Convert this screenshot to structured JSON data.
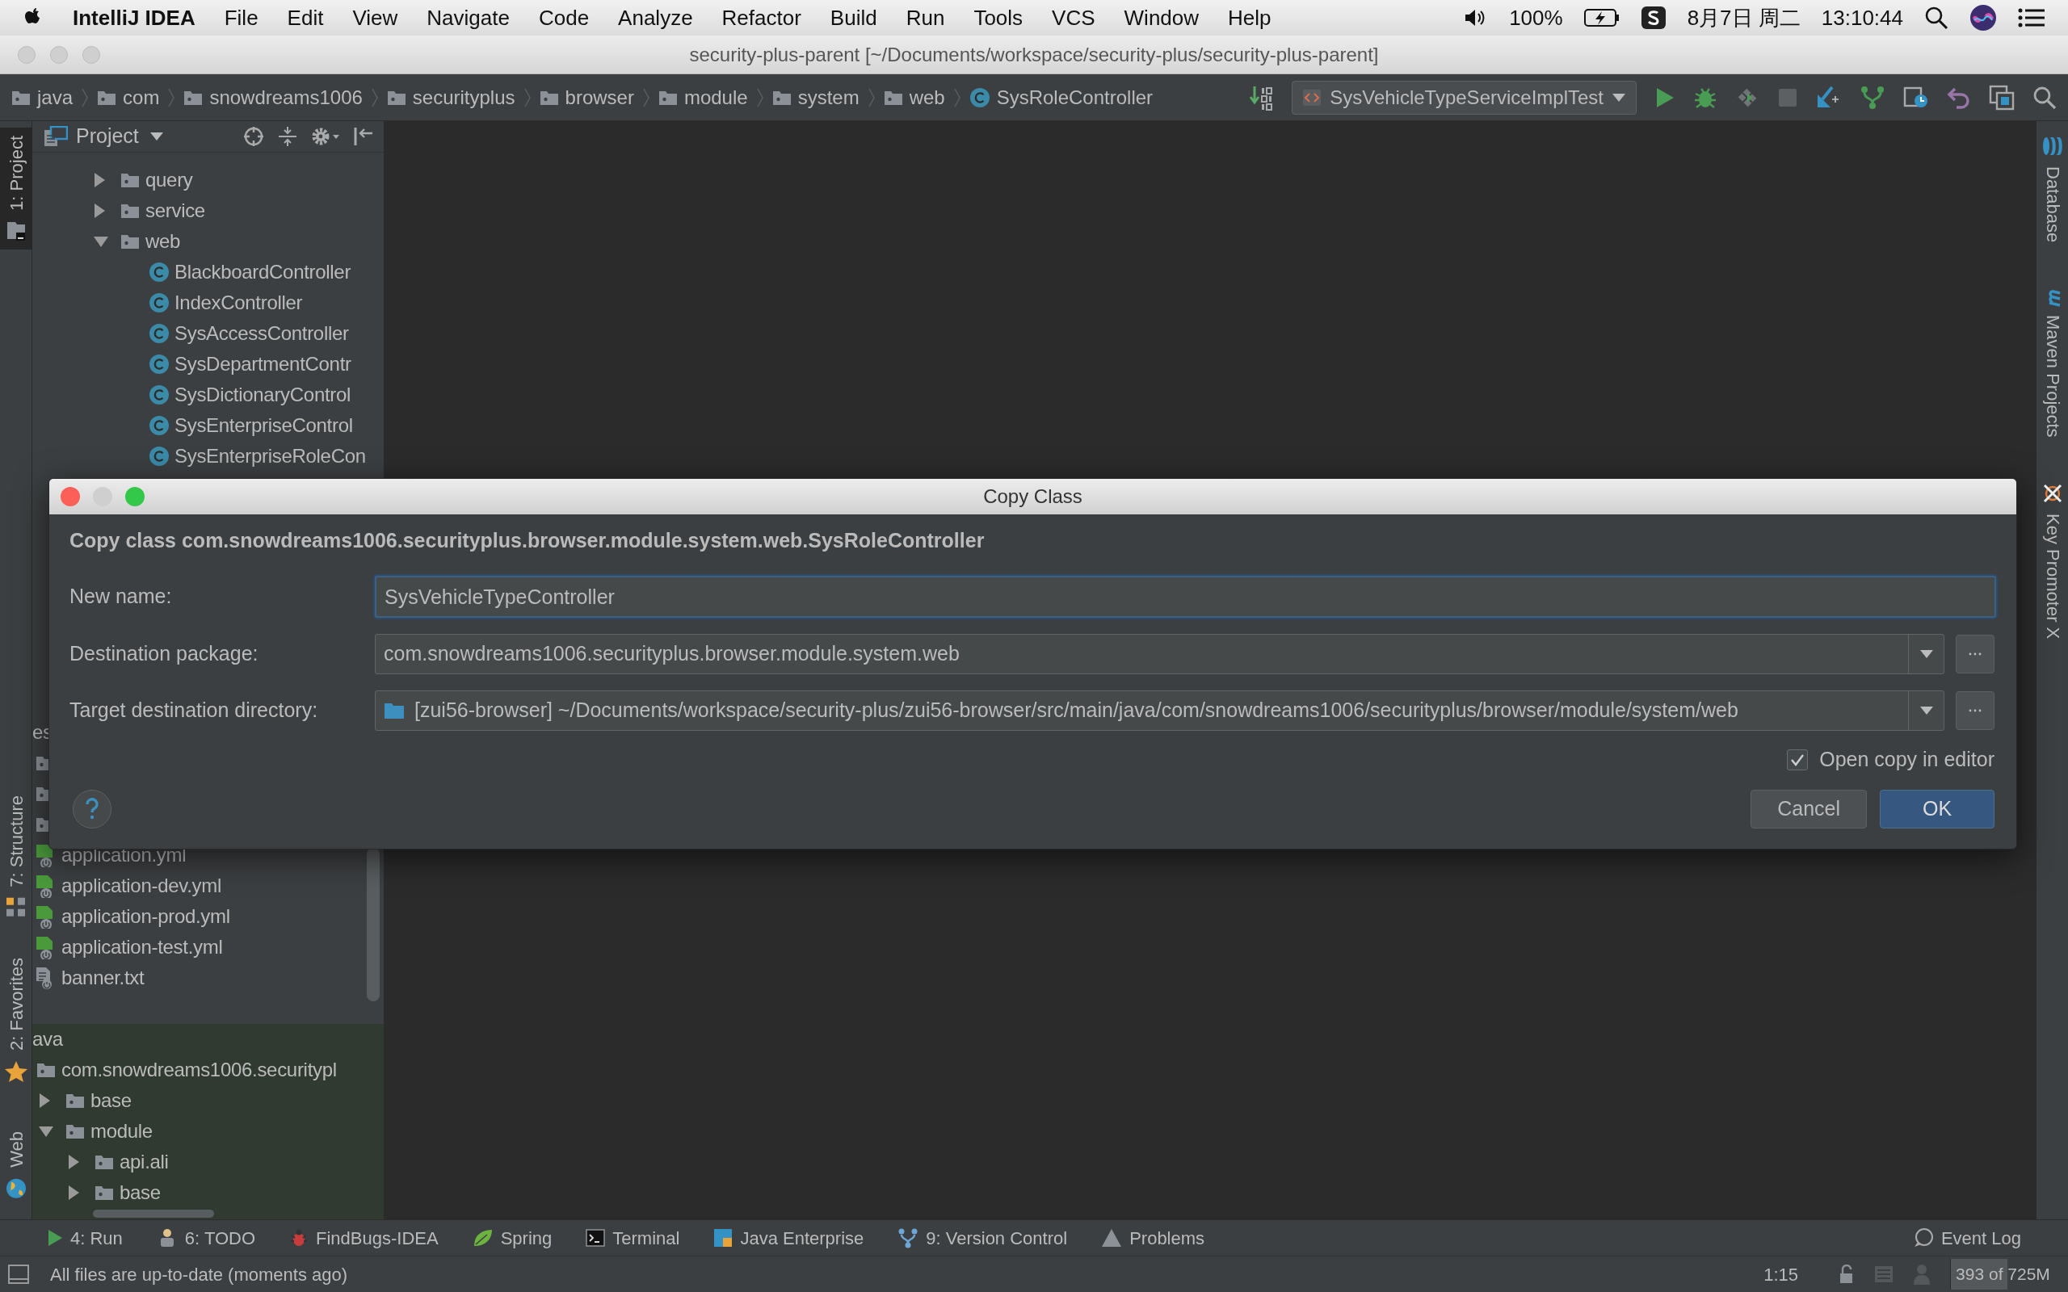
{
  "menu_bar": {
    "app_name": "IntelliJ IDEA",
    "menus": [
      "File",
      "Edit",
      "View",
      "Navigate",
      "Code",
      "Analyze",
      "Refactor",
      "Build",
      "Run",
      "Tools",
      "VCS",
      "Window",
      "Help"
    ],
    "battery": "100%",
    "date": "8月7日 周二",
    "time": "13:10:44"
  },
  "window": {
    "title": "security-plus-parent [~/Documents/workspace/security-plus/security-plus-parent]"
  },
  "breadcrumbs": [
    {
      "label": "java",
      "kind": "folder"
    },
    {
      "label": "com",
      "kind": "folder"
    },
    {
      "label": "snowdreams1006",
      "kind": "folder"
    },
    {
      "label": "securityplus",
      "kind": "folder"
    },
    {
      "label": "browser",
      "kind": "folder"
    },
    {
      "label": "module",
      "kind": "folder"
    },
    {
      "label": "system",
      "kind": "folder"
    },
    {
      "label": "web",
      "kind": "folder"
    },
    {
      "label": "SysRoleController",
      "kind": "class"
    }
  ],
  "run_config": {
    "label": "SysVehicleTypeServiceImplTest"
  },
  "left_tool_tabs": [
    {
      "label": "1: Project",
      "kind": "project",
      "selected": true
    },
    {
      "label": "7: Structure",
      "kind": "structure",
      "selected": false
    },
    {
      "label": "2: Favorites",
      "kind": "favorites",
      "selected": false
    },
    {
      "label": "Web",
      "kind": "web",
      "selected": false
    }
  ],
  "right_tool_tabs": [
    {
      "label": "Database",
      "kind": "database"
    },
    {
      "label": "Maven Projects",
      "kind": "maven"
    },
    {
      "label": "Key Promoter X",
      "kind": "keypromoter"
    }
  ],
  "project_panel": {
    "title": "Project",
    "tree": [
      {
        "label": "query",
        "kind": "folder",
        "expanded": false
      },
      {
        "label": "service",
        "kind": "folder",
        "expanded": false
      },
      {
        "label": "web",
        "kind": "folder",
        "expanded": true,
        "children": [
          {
            "label": "BlackboardController",
            "kind": "class"
          },
          {
            "label": "IndexController",
            "kind": "class"
          },
          {
            "label": "SysAccessController",
            "kind": "class"
          },
          {
            "label": "SysDepartmentContr",
            "kind": "class"
          },
          {
            "label": "SysDictionaryControl",
            "kind": "class"
          },
          {
            "label": "SysEnterpriseControl",
            "kind": "class"
          },
          {
            "label": "SysEnterpriseRoleCon",
            "kind": "class"
          }
        ]
      }
    ],
    "tree_middle": [
      {
        "label": "es",
        "children": [
          {
            "kind": "folder"
          },
          {
            "kind": "folder"
          },
          {
            "kind": "folder"
          },
          {
            "label": "application.yml",
            "kind": "spring-config"
          },
          {
            "label": "application-dev.yml",
            "kind": "spring-config"
          },
          {
            "label": "application-prod.yml",
            "kind": "spring-config"
          },
          {
            "label": "application-test.yml",
            "kind": "spring-config"
          },
          {
            "label": "banner.txt",
            "kind": "text-file"
          }
        ]
      }
    ],
    "tree_bottom": [
      {
        "label": "ava",
        "children": [
          {
            "label": "com.snowdreams1006.securitypl",
            "kind": "folder",
            "children": [
              {
                "label": "base",
                "kind": "folder",
                "expanded": false
              },
              {
                "label": "module",
                "kind": "folder",
                "expanded": true,
                "children": [
                  {
                    "label": "api.ali",
                    "kind": "folder",
                    "expanded": false
                  },
                  {
                    "label": "base",
                    "kind": "folder",
                    "expanded": false
                  }
                ]
              }
            ]
          }
        ]
      }
    ]
  },
  "dialog": {
    "title": "Copy Class",
    "heading": "Copy class com.snowdreams1006.securityplus.browser.module.system.web.SysRoleController",
    "fields": [
      {
        "label": "New name:",
        "kind": "text",
        "value": "SysVehicleTypeController",
        "focused": true
      },
      {
        "label": "Destination package:",
        "kind": "combo",
        "value": "com.snowdreams1006.securityplus.browser.module.system.web",
        "focused": false
      },
      {
        "label": "Target destination directory:",
        "kind": "directory",
        "value": "[zui56-browser] ~/Documents/workspace/security-plus/zui56-browser/src/main/java/com/snowdreams1006/securityplus/browser/module/system/web",
        "focused": false
      }
    ],
    "open_copy": {
      "label": "Open copy in editor",
      "checked": true
    },
    "buttons": [
      {
        "label": "Cancel",
        "default": false
      },
      {
        "label": "OK",
        "default": true
      }
    ]
  },
  "tool_window_bar": [
    {
      "label": "4: Run",
      "kind": "run"
    },
    {
      "label": "6: TODO",
      "kind": "todo"
    },
    {
      "label": "FindBugs-IDEA",
      "kind": "findbugs"
    },
    {
      "label": "Spring",
      "kind": "spring"
    },
    {
      "label": "Terminal",
      "kind": "terminal"
    },
    {
      "label": "Java Enterprise",
      "kind": "javaee"
    },
    {
      "label": "9: Version Control",
      "kind": "vcs"
    },
    {
      "label": "Problems",
      "kind": "problems"
    }
  ],
  "event_log": "Event Log",
  "status_bar": {
    "message": "All files are up-to-date (moments ago)",
    "position": "1:15",
    "memory": {
      "reading": "393 of 725M",
      "level": 0.54
    }
  }
}
